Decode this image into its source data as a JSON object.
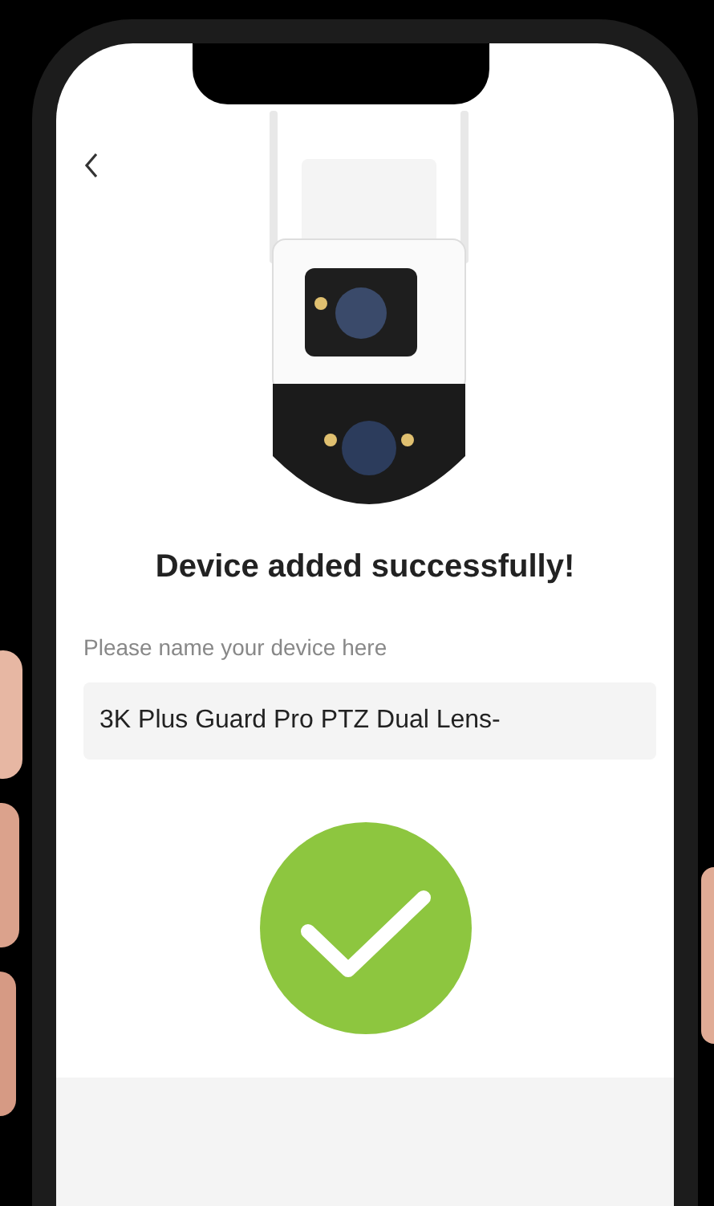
{
  "screen": {
    "title": "Device added successfully!",
    "name_prompt": "Please name your device here",
    "device_name_field": {
      "value": "3K Plus Guard Pro PTZ Dual Lens-"
    }
  }
}
